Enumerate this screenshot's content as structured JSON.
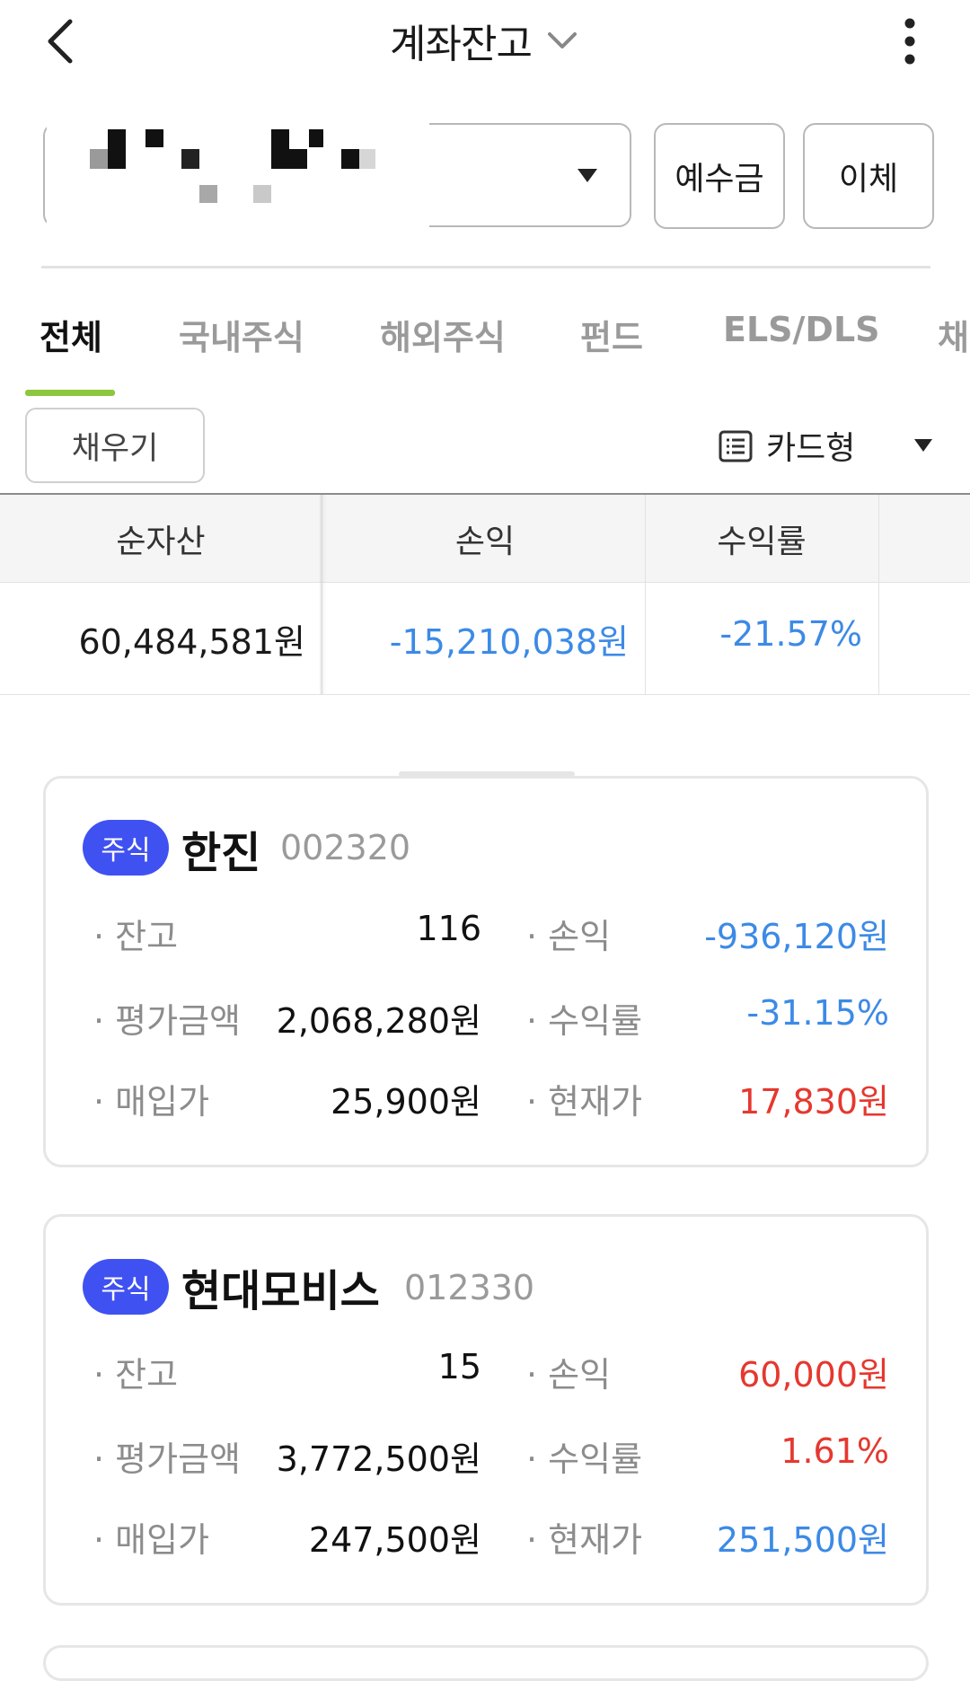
{
  "header": {
    "title": "계좌잔고"
  },
  "account_bar": {
    "deposit_label": "예수금",
    "transfer_label": "이체"
  },
  "tabs": [
    {
      "label": "전체",
      "active": true
    },
    {
      "label": "국내주식",
      "active": false
    },
    {
      "label": "해외주식",
      "active": false
    },
    {
      "label": "펀드",
      "active": false
    },
    {
      "label": "ELS/DLS",
      "active": false
    },
    {
      "label": "채",
      "active": false
    }
  ],
  "toolbar": {
    "fill_label": "채우기",
    "view_label": "카드형"
  },
  "summary": {
    "headers": [
      "순자산",
      "손익",
      "수익률"
    ],
    "values": [
      "60,484,581원",
      "-15,210,038원",
      "-21.57%"
    ]
  },
  "holdings": [
    {
      "badge": "주식",
      "name": "한진",
      "code": "002320",
      "rows": [
        {
          "left_label": "잔고",
          "left_value": "116",
          "right_label": "손익",
          "right_value": "-936,120원"
        },
        {
          "left_label": "평가금액",
          "left_value": "2,068,280원",
          "right_label": "수익률",
          "right_value": "-31.15%"
        },
        {
          "left_label": "매입가",
          "left_value": "25,900원",
          "right_label": "현재가",
          "right_value": "17,830원"
        }
      ]
    },
    {
      "badge": "주식",
      "name": "현대모비스",
      "code": "012330",
      "rows": [
        {
          "left_label": "잔고",
          "left_value": "15",
          "right_label": "손익",
          "right_value": "60,000원"
        },
        {
          "left_label": "평가금액",
          "left_value": "3,772,500원",
          "right_label": "수익률",
          "right_value": "1.61%"
        },
        {
          "left_label": "매입가",
          "left_value": "247,500원",
          "right_label": "현재가",
          "right_value": "251,500원"
        }
      ]
    }
  ],
  "colors": {
    "accent_tab": "#8dc63f",
    "badge": "#4051f2",
    "negative": "#3c8ae6",
    "positive": "#e5382f"
  }
}
